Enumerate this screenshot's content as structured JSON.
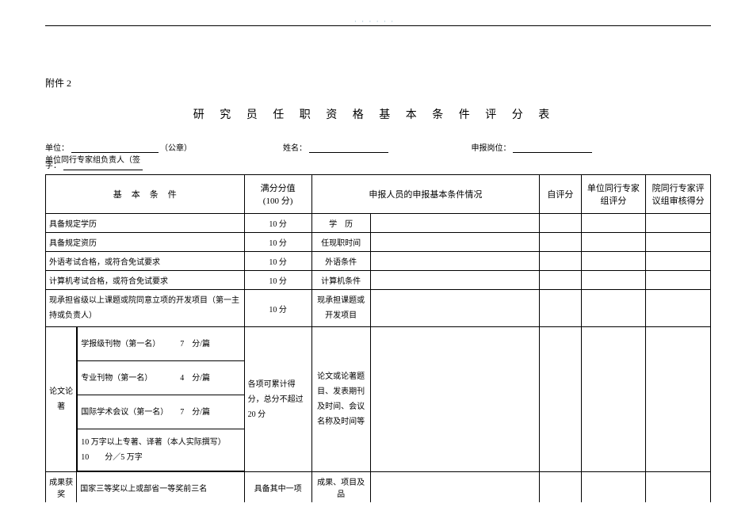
{
  "page_marker": "· · · · · ·",
  "attachment": "附件 2",
  "title": "研 究 员 任 职 资 格 基 本 条 件 评 分 表",
  "meta": {
    "unit_label": "单位：",
    "unit_suffix": "（公章）",
    "name_label": "姓名：",
    "position_label": "申报岗位：",
    "signer_label": "单位同行专家组负责人（签",
    "signer_label2": "字：",
    "placeholder": ""
  },
  "headers": {
    "basic": "基本条件",
    "full_score": "满分分值",
    "full_score_sub": "(100 分)",
    "applicant_info": "申报人员的申报基本条件情况",
    "self_score": "自评分",
    "unit_group_score": "单位同行专家组评分",
    "inst_group_score": "院同行专家评议组审核得分"
  },
  "rows": {
    "r1": {
      "cond": "具备规定学历",
      "score": "10 分",
      "label": "学　历"
    },
    "r2": {
      "cond": "具备规定资历",
      "score": "10 分",
      "label": "任现职时间"
    },
    "r3": {
      "cond": "外语考试合格，或符合免试要求",
      "score": "10 分",
      "label": "外语条件"
    },
    "r4": {
      "cond": "计算机考试合格，或符合免试要求",
      "score": "10 分",
      "label": "计算机条件"
    },
    "r5": {
      "cond": "现承担省级以上课题或院同意立项的开发项目（第一主持或负责人）",
      "score": "10 分",
      "label": "现承担课题或开发项目"
    },
    "r6": {
      "group": "论文论著",
      "sub1": "学报级刊物（第一名）　　　7　分/篇",
      "sub2": "专业刊物（第一名）　　　　4　分/篇",
      "sub3": "国际学术会议（第一名）　　7　分/篇",
      "sub4": "10 万字以上专著、译著（本人实际撰写）　　　10　　分／5 万字",
      "score": "各项可累计得分，总分不超过20 分",
      "label": "论文或论著题目、发表期刊及时间、会议名称及时间等"
    },
    "r7": {
      "group": "成果获奖",
      "cond": "国家三等奖以上或部省一等奖前三名",
      "score": "具备其中一项",
      "label": "成果、项目及品"
    }
  }
}
